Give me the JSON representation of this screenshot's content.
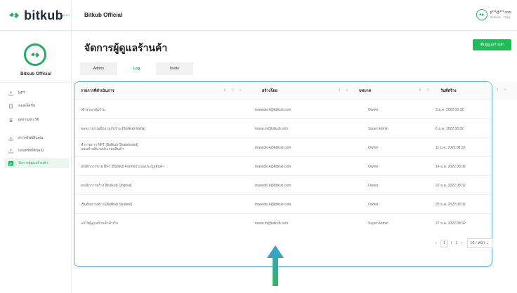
{
  "brand": {
    "name": "bitkub",
    "sub": "ART"
  },
  "header": {
    "shop_title": "Bitkub Official",
    "user_email": "p***@***.com",
    "user_wallet": "0x9ea8...7a5g"
  },
  "sidebar": {
    "name": "Bitkub Official",
    "items": [
      {
        "label": "NFT",
        "icon": "upload-icon",
        "active": false
      },
      {
        "label": "คอลเล็คชั่น",
        "icon": "document-icon",
        "active": false
      },
      {
        "label": "ผลงานประวัติ",
        "icon": "grid-icon",
        "active": false
      },
      {
        "label": "ฝากทรัพย์สินคุณ",
        "icon": "download-icon",
        "active": false
      },
      {
        "label": "ถอนทรัพย์สินคุณ",
        "icon": "upload-icon",
        "active": false
      },
      {
        "label": "จัดการผู้ดูแลร้านค้า",
        "icon": "manage-icon",
        "active": true
      }
    ]
  },
  "main": {
    "title": "จัดการผู้ดูแลร้านค้า",
    "add_button": "เพิ่มผู้ดูแลร้านค้า",
    "tabs": [
      {
        "label": "Admin",
        "active": false
      },
      {
        "label": "Log",
        "active": true
      },
      {
        "label": "Invite",
        "active": false
      }
    ]
  },
  "table": {
    "columns": [
      "รายการที่ดำเนินการ",
      "สร้างโดย",
      "บทบาท",
      "วันที่สร้าง"
    ],
    "rows": [
      {
        "action": "เข้าร่วมกลุ่มร้าน",
        "by": "manode.k@bitkub.com",
        "role": "Owner",
        "date": "3 ม.ค. 2022 08:32"
      },
      {
        "action": "ขอความร่วมมือร่วมกับร้าน [Bullkub Mafia]",
        "by": "mana.m@bitkub.com",
        "role": "Super Admin",
        "date": "6 ม.ค. 2022 08:32"
      },
      {
        "action": "ทำรายการ NFT [Bullkub Skateboard]",
        "action2": "แนบคำอธิบายประกอบสินค้า",
        "by": "manode.k@bitkub.com",
        "role": "Owner",
        "date": "11 ม.ค. 2022 08:32"
      },
      {
        "action": "ยกเลิกการขาย NFT [Bullkub Farmer] แบบประมูลสินค้า",
        "by": "manode.k@bitkub.com",
        "role": "Owner",
        "date": "14 ม.ค. 2022 08:32"
      },
      {
        "action": "ยกเลิกการสร้าง [Bullkub Original]",
        "by": "manode.k@bitkub.com",
        "role": "Owner",
        "date": "22 ม.ค. 2022 08:32"
      },
      {
        "action": "เริ่มต้นการสร้าง [Bullkub Student]",
        "by": "manode.k@bitkub.com",
        "role": "Owner",
        "date": "25 ม.ค. 2022 08:32"
      },
      {
        "action": "แก้ไขผู้ดูแลร้านค้าสำเร็จ",
        "by": "mana.m@bitkub.com",
        "role": "Super Admin",
        "date": "27 ม.ค. 2022 08:32"
      }
    ]
  },
  "pagination": {
    "current": "1",
    "sep": "/",
    "total": "1",
    "page_size": "10 / หน้า"
  },
  "colors": {
    "accent": "#27ad61",
    "button": "#1ebd5a",
    "highlight_border": "#5aa8e6",
    "arrow_top": "#3aa0d8",
    "arrow_bottom": "#2fb85a"
  }
}
